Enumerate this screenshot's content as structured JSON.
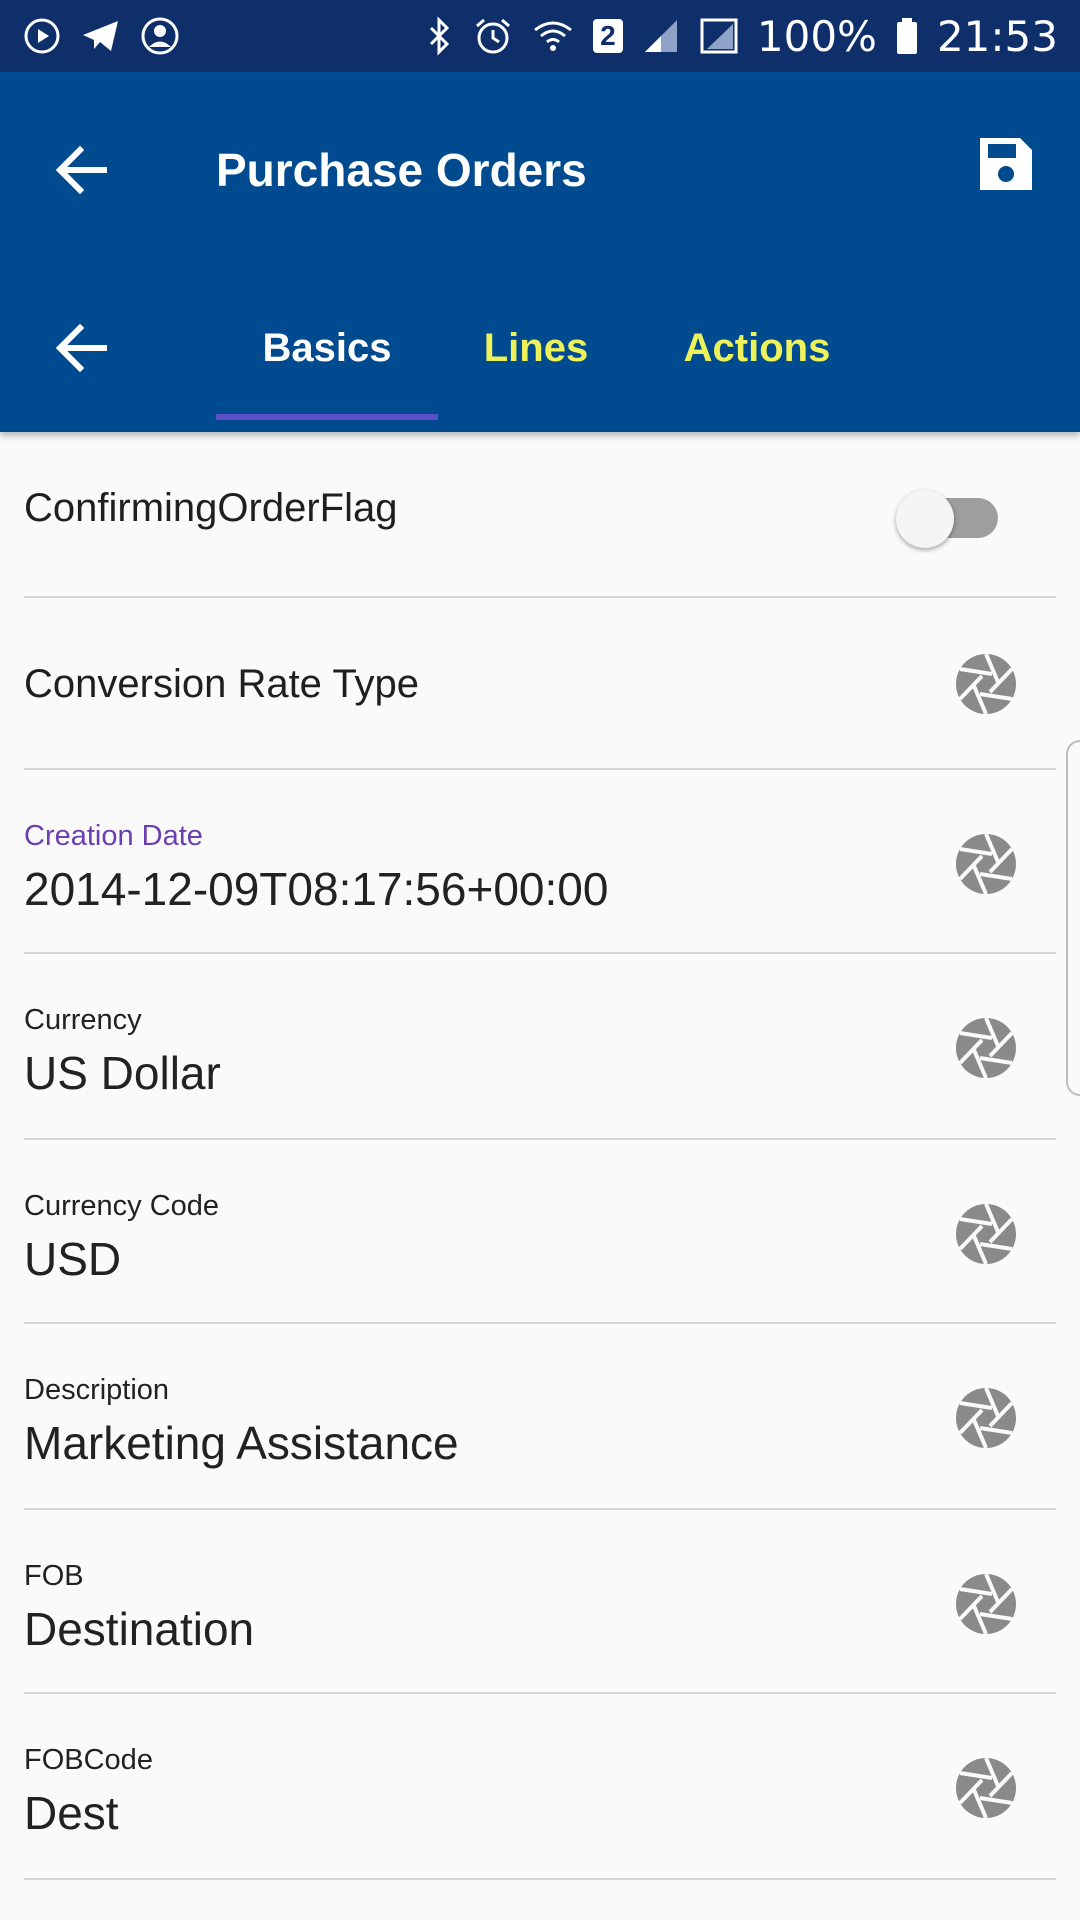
{
  "status_bar": {
    "battery": "100%",
    "time": "21:53",
    "sim_badge": "2",
    "icons": [
      "play-circle-icon",
      "telegram-icon",
      "account-circle-icon",
      "bluetooth-icon",
      "alarm-icon",
      "wifi-icon",
      "signal-icon",
      "roaming-signal-icon",
      "battery-icon"
    ]
  },
  "app_bar": {
    "title": "Purchase Orders",
    "back_icon": "arrow-back-icon",
    "save_icon": "save-icon"
  },
  "tabs": [
    {
      "label": "Basics",
      "selected": true
    },
    {
      "label": "Lines",
      "selected": false
    },
    {
      "label": "Actions",
      "selected": false
    }
  ],
  "colors": {
    "app_bar": "#004a8f",
    "status_bar": "#0f2f6b",
    "tab_active_text": "#ffffff",
    "tab_inactive_text": "#eef25a",
    "tab_indicator": "#5c4fc7",
    "focused_label": "#6a3fb0"
  },
  "fields": {
    "confirming_order_flag": {
      "label": "ConfirmingOrderFlag",
      "on": false
    },
    "conversion_rate_type": {
      "label": "Conversion Rate Type"
    },
    "creation_date": {
      "label": "Creation Date",
      "value": "2014-12-09T08:17:56+00:00"
    },
    "currency": {
      "label": "Currency",
      "value": "US Dollar"
    },
    "currency_code": {
      "label": "Currency Code",
      "value": "USD"
    },
    "description": {
      "label": "Description",
      "value": "Marketing Assistance"
    },
    "fob": {
      "label": "FOB",
      "value": "Destination"
    },
    "fob_code": {
      "label": "FOBCode",
      "value": "Dest"
    }
  }
}
